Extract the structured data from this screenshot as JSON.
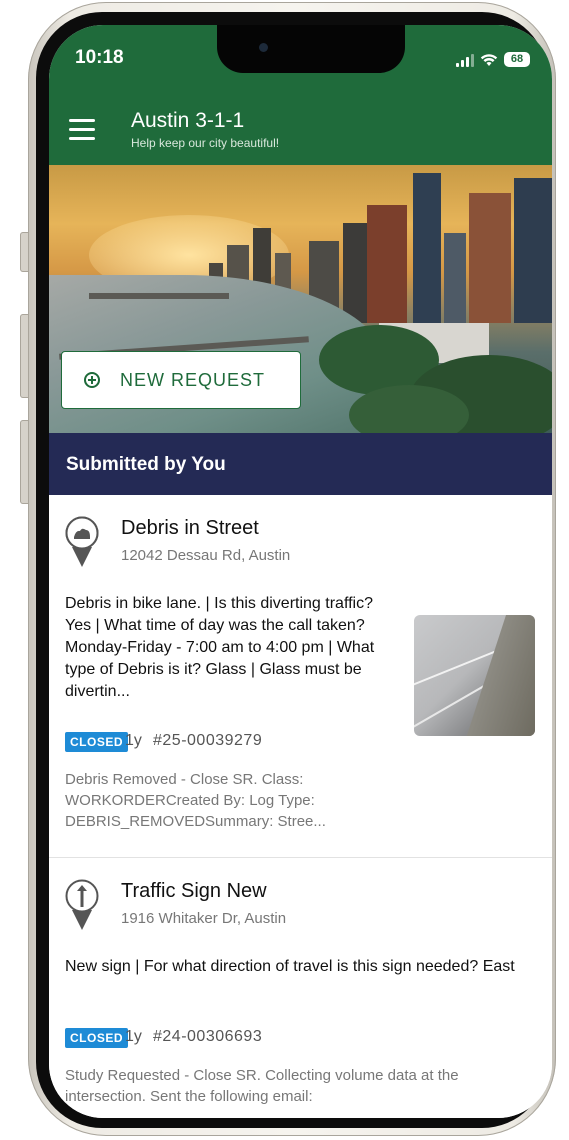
{
  "status_bar": {
    "time": "10:18",
    "battery": "68"
  },
  "header": {
    "title": "Austin 3-1-1",
    "subtitle": "Help keep our city beautiful!"
  },
  "hero": {
    "new_request_label": "NEW REQUEST"
  },
  "section": {
    "title": "Submitted by You"
  },
  "requests": [
    {
      "title": "Debris in Street",
      "address": "12042 Dessau Rd, Austin",
      "description": "Debris in bike lane. | Is this diverting traffic? Yes | What time of day was the call taken? Monday-Friday - 7:00 am to 4:00 pm | What type of Debris is it? Glass | Glass must be divertin...",
      "status": "CLOSED",
      "age": "1y",
      "case_number": "#25-00039279",
      "note": "Debris Removed - Close SR. Class: WORKORDERCreated By: Log Type: DEBRIS_REMOVEDSummary: Stree..."
    },
    {
      "title": "Traffic Sign New",
      "address": "1916 Whitaker Dr, Austin",
      "description": "New sign | For what direction of travel is this sign needed? East",
      "status": "CLOSED",
      "age": "1y",
      "case_number": "#24-00306693",
      "note": "Study Requested - Close SR. Collecting volume data at the intersection. Sent the following email:"
    }
  ],
  "colors": {
    "brand_green": "#1f6b3b",
    "navy": "#242a55",
    "badge_blue": "#1e8bd6"
  },
  "icons": [
    "menu-icon",
    "plus-circle-icon",
    "debris-pin-icon",
    "sign-pin-icon",
    "signal-icon",
    "wifi-icon",
    "battery-icon"
  ]
}
